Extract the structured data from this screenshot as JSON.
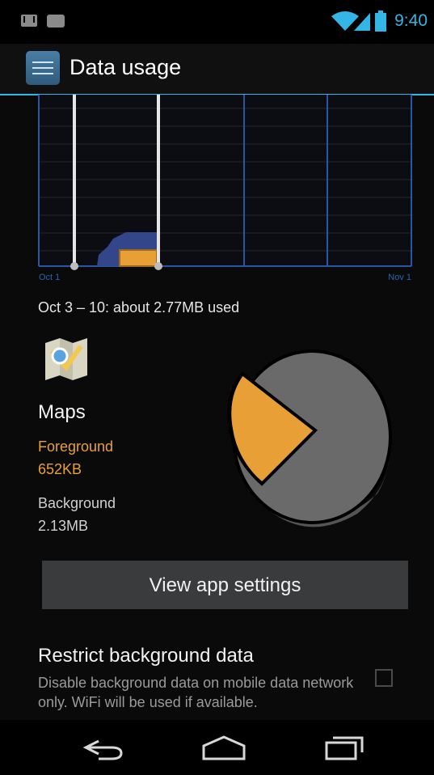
{
  "status_bar": {
    "time": "9:40",
    "notifications": [
      "gmail-icon",
      "talk-icon"
    ],
    "indicators": [
      "wifi-icon",
      "signal-icon",
      "battery-icon"
    ],
    "accent_color": "#33b5e5"
  },
  "action_bar": {
    "title": "Data usage",
    "icon": "data-usage-app-icon"
  },
  "chart": {
    "start_label": "Oct 1",
    "end_label": "Nov 1"
  },
  "summary": {
    "range_text": "Oct 3 – 10: about 2.77MB used"
  },
  "app": {
    "icon": "maps-app-icon",
    "name": "Maps",
    "foreground_label": "Foreground",
    "foreground_value": "652KB",
    "background_label": "Background",
    "background_value": "2.13MB",
    "foreground_color": "#e8a036",
    "background_color": "#6a6a6a"
  },
  "actions": {
    "view_settings_label": "View app settings"
  },
  "restrict": {
    "title": "Restrict background data",
    "description": "Disable background data on mobile data network only. WiFi will be used if available.",
    "checked": false
  },
  "nav_bar": {
    "buttons": [
      "back-icon",
      "home-icon",
      "recents-icon"
    ]
  }
}
